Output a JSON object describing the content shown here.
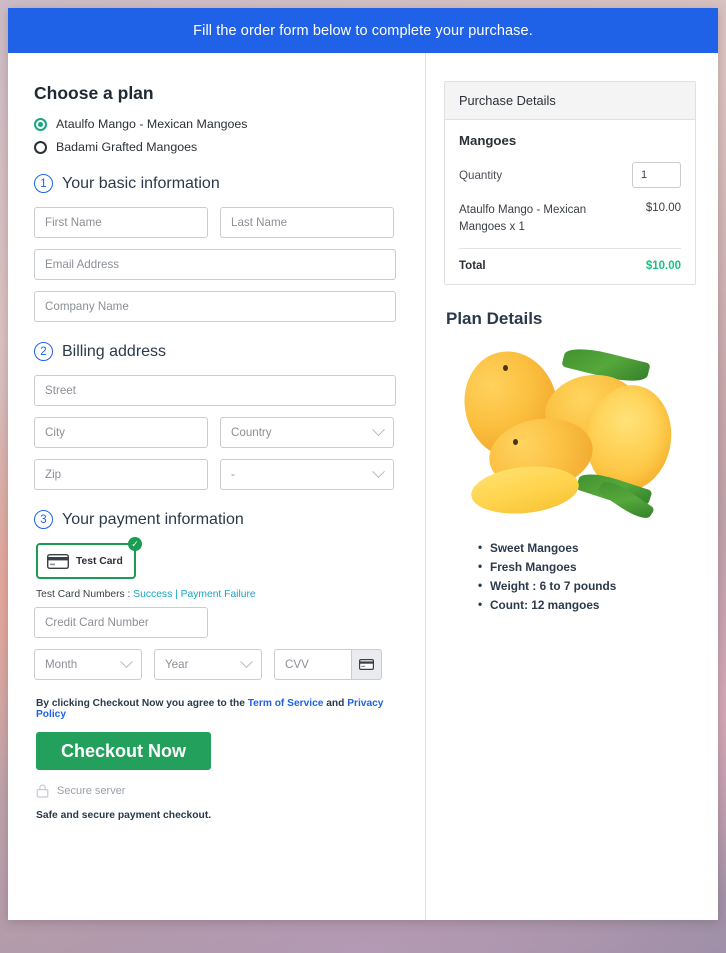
{
  "banner": {
    "text": "Fill the order form below to complete your purchase."
  },
  "plan": {
    "title": "Choose a plan",
    "options": [
      {
        "label": "Ataulfo Mango - Mexican Mangoes",
        "selected": true
      },
      {
        "label": "Badami Grafted Mangoes",
        "selected": false
      }
    ]
  },
  "section1": {
    "number": "1",
    "title": "Your basic information",
    "first_name_placeholder": "First Name",
    "last_name_placeholder": "Last Name",
    "email_placeholder": "Email Address",
    "company_placeholder": "Company Name"
  },
  "section2": {
    "number": "2",
    "title": "Billing address",
    "street_placeholder": "Street",
    "city_placeholder": "City",
    "country_placeholder": "Country",
    "zip_placeholder": "Zip",
    "state_placeholder": "-"
  },
  "section3": {
    "number": "3",
    "title": "Your payment information",
    "card_tile_label": "Test  Card",
    "card_tile_selected_icon": "check-circle-icon",
    "test_card_label": "Test Card Numbers :",
    "test_card_success": "Success",
    "test_card_separator": "|",
    "test_card_failure": "Payment Failure",
    "card_number_placeholder": "Credit Card Number",
    "month_placeholder": "Month",
    "year_placeholder": "Year",
    "cvv_placeholder": "CVV"
  },
  "footer": {
    "terms_prefix": "By clicking Checkout Now you agree to the ",
    "terms_link": "Term of Service",
    "terms_middle": " and ",
    "privacy_link": "Privacy Policy",
    "checkout_label": "Checkout Now",
    "secure_server": "Secure server",
    "safe_note": "Safe and secure payment checkout."
  },
  "purchase": {
    "header": "Purchase Details",
    "product": "Mangoes",
    "quantity_label": "Quantity",
    "quantity_value": "1",
    "line_item_name": "Ataulfo Mango - Mexican Mangoes x 1",
    "line_item_price": "$10.00",
    "total_label": "Total",
    "total_amount": "$10.00",
    "total_color": "#17c480"
  },
  "plan_details": {
    "title": "Plan Details",
    "image_alt": "mangoes-photo",
    "features": [
      "Sweet Mangoes",
      "Fresh Mangoes",
      "Weight : 6 to 7 pounds",
      "Count: 12 mangoes"
    ]
  },
  "colors": {
    "banner_blue": "#1f62e8",
    "checkout_green": "#23a05b",
    "selected_green": "#17a77e",
    "link_blue": "#1f62e8",
    "link_teal": "#1aa6c4"
  }
}
